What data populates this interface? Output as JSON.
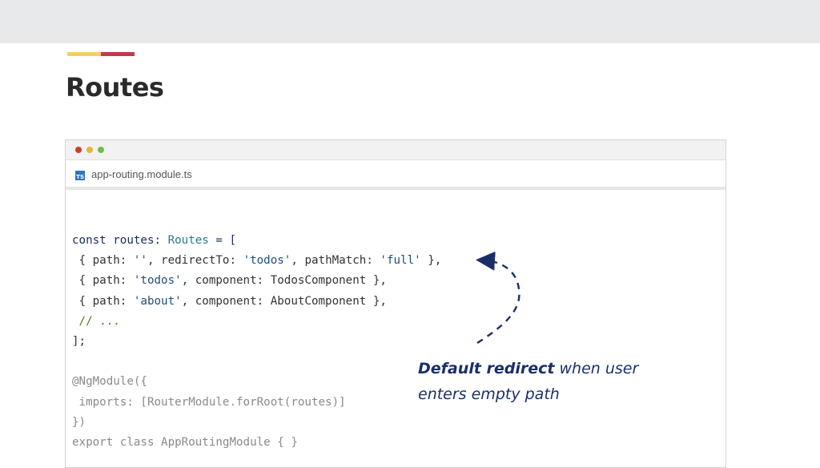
{
  "page": {
    "title": "Routes"
  },
  "editor": {
    "filename": "app-routing.module.ts",
    "file_icon_label": "TS",
    "window_controls": [
      "close",
      "minimize",
      "maximize"
    ]
  },
  "code": {
    "lines": [
      [
        {
          "t": "kw",
          "v": "const routes: "
        },
        {
          "t": "type",
          "v": "Routes"
        },
        {
          "t": "kw",
          "v": " = ["
        }
      ],
      [
        {
          "t": "plain",
          "v": " { path: "
        },
        {
          "t": "str",
          "v": "''"
        },
        {
          "t": "plain",
          "v": ", redirectTo: "
        },
        {
          "t": "str",
          "v": "'todos'"
        },
        {
          "t": "plain",
          "v": ", pathMatch: "
        },
        {
          "t": "str",
          "v": "'full'"
        },
        {
          "t": "plain",
          "v": " },"
        }
      ],
      [
        {
          "t": "plain",
          "v": " { path: "
        },
        {
          "t": "str",
          "v": "'todos'"
        },
        {
          "t": "plain",
          "v": ", component: TodosComponent },"
        }
      ],
      [
        {
          "t": "plain",
          "v": " { path: "
        },
        {
          "t": "str",
          "v": "'about'"
        },
        {
          "t": "plain",
          "v": ", component: AboutComponent },"
        }
      ],
      [
        {
          "t": "comment",
          "v": " // ..."
        }
      ],
      [
        {
          "t": "plain",
          "v": "];"
        }
      ],
      [
        {
          "t": "plain",
          "v": ""
        }
      ],
      [
        {
          "t": "dim",
          "v": "@NgModule({"
        }
      ],
      [
        {
          "t": "dim",
          "v": " imports: [RouterModule.forRoot(routes)]"
        }
      ],
      [
        {
          "t": "dim",
          "v": "})"
        }
      ],
      [
        {
          "t": "dim",
          "v": "export class AppRoutingModule { }"
        }
      ]
    ]
  },
  "annotation": {
    "bold_text": "Default redirect",
    "text_after": " when user",
    "line2": "enters empty path"
  },
  "colors": {
    "accent_yellow": "#f1cf6a",
    "accent_red": "#c23a4e",
    "annotation": "#1a2f6a",
    "ts_icon": "#2f74c0"
  }
}
